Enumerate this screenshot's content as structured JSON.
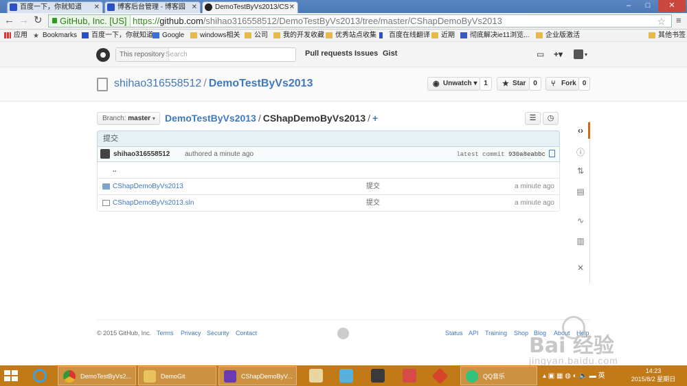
{
  "browser": {
    "tabs": [
      {
        "title": "百度一下，你就知道"
      },
      {
        "title": "博客后台管理 - 博客园"
      },
      {
        "title": "DemoTestByVs2013/CS"
      }
    ],
    "window_controls": [
      "–",
      "□",
      "✕"
    ],
    "address": {
      "ev_label": "GitHub, Inc. [US]",
      "url_proto": "https://",
      "url_host": "github.com",
      "url_path": "/shihao316558512/DemoTestByVs2013/tree/master/CShapDemoByVs2013"
    },
    "bookmarks": [
      {
        "label": "应用",
        "icon": "apps-icon"
      },
      {
        "label": "Bookmarks",
        "icon": "star-icon"
      },
      {
        "label": "百度一下，你就知道",
        "icon": "baidu-icon"
      },
      {
        "label": "Google",
        "icon": "google-icon"
      },
      {
        "label": "windows相关",
        "icon": "folder-icon"
      },
      {
        "label": "公司",
        "icon": "folder-icon"
      },
      {
        "label": "我的开发收藏",
        "icon": "folder-icon"
      },
      {
        "label": "优秀站点收集",
        "icon": "folder-icon"
      },
      {
        "label": "百度在线翻译",
        "icon": "translate-icon"
      },
      {
        "label": "近期",
        "icon": "folder-icon"
      },
      {
        "label": "彻底解决ie11浏览...",
        "icon": "page-icon"
      },
      {
        "label": "企业版激活",
        "icon": "folder-icon"
      },
      {
        "label": "其他书签",
        "icon": "folder-icon"
      }
    ]
  },
  "github": {
    "search_scope": "This repository",
    "search_placeholder": "Search",
    "nav": [
      "Pull requests",
      "Issues",
      "Gist"
    ],
    "header_icons": [
      "notifications-icon",
      "plus-icon",
      "avatar"
    ],
    "repo": {
      "owner": "shihao316558512",
      "separator": "/",
      "name": "DemoTestByVs2013"
    },
    "actions": {
      "watch_label": "Unwatch ▾",
      "watch_count": "1",
      "star_label": "Star",
      "star_count": "0",
      "fork_label": "Fork",
      "fork_count": "0"
    },
    "branch": {
      "label": "Branch:",
      "value": "master"
    },
    "breadcrumb": {
      "root": "DemoTestByVs2013",
      "sep": "/",
      "current": "CShapDemoByVs2013",
      "add": "+"
    },
    "commit": {
      "message": "提交",
      "author": "shihao316558512",
      "authored": "authored a minute ago",
      "latest_label": "latest commit",
      "sha": "930a8eabbc"
    },
    "parent_dir": "..",
    "files": [
      {
        "name": "CShapDemoByVs2013",
        "type": "dir",
        "message": "提交",
        "age": "a minute ago"
      },
      {
        "name": "CShapDemoByVs2013.sln",
        "type": "file",
        "message": "提交",
        "age": "a minute ago"
      }
    ],
    "sidebar_icons": [
      "code-icon",
      "issues-icon",
      "pull-requests-icon",
      "wiki-icon",
      "pulse-icon",
      "graphs-icon",
      "settings-icon"
    ],
    "footer": {
      "copyright": "© 2015 GitHub, Inc.",
      "left_links": [
        "Terms",
        "Privacy",
        "Security",
        "Contact"
      ],
      "right_links": [
        "Status",
        "API",
        "Training",
        "Shop",
        "Blog",
        "About",
        "Help"
      ]
    }
  },
  "watermark": {
    "big": "Bai 经验",
    "small": "jingyan.baidu.com"
  },
  "taskbar": {
    "tasks": [
      {
        "label": "DemoTestByVs2...",
        "icon": "chrome-icon"
      },
      {
        "label": "DemoGit",
        "icon": "folder-icon"
      },
      {
        "label": "CShapDemoByV...",
        "icon": "visual-studio-icon"
      },
      {
        "label": "QQ音乐",
        "icon": "qq-music-icon"
      }
    ],
    "tray_lang": "英",
    "time": "14:23",
    "date": "2015/8/2 星期日"
  },
  "colors": {
    "link": "#4078c0",
    "taskbar": "#c27a18",
    "commit_bar": "#e6f1f6",
    "sidebar_active": "#d26911"
  }
}
